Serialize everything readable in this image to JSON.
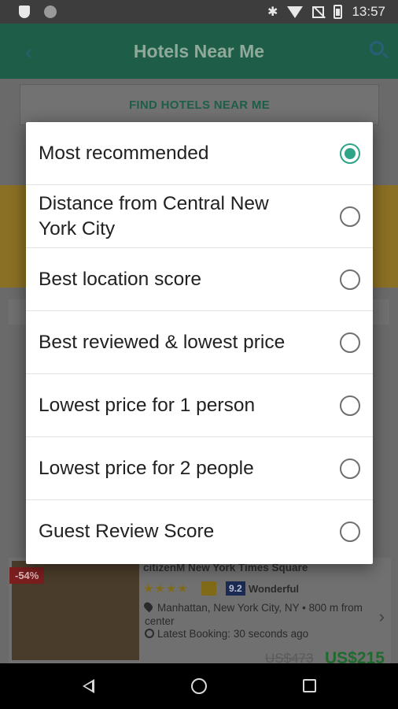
{
  "status_bar": {
    "time": "13:57",
    "icons": [
      "shield-icon",
      "circle-icon",
      "bluetooth-icon",
      "wifi-icon",
      "no-signal-icon",
      "battery-icon"
    ]
  },
  "app_bar": {
    "title": "Hotels Near Me",
    "back_icon": "back-arrow-icon",
    "search_icon": "search-icon"
  },
  "background": {
    "find_button_label": "FIND HOTELS NEAR ME",
    "hotel": {
      "discount": "-54%",
      "name": "citizenM New York Times Square",
      "stars": "★★★★",
      "score": "9.2",
      "score_label": "Wonderful",
      "location": "Manhattan, New York City, NY • 800 m from center",
      "latest_booking": "Latest Booking: 30 seconds ago",
      "old_price": "US$473",
      "price": "US$215"
    }
  },
  "sort_dialog": {
    "options": [
      {
        "label": "Most recommended",
        "selected": true
      },
      {
        "label": "Distance from Central New York City",
        "selected": false
      },
      {
        "label": "Best location score",
        "selected": false
      },
      {
        "label": "Best reviewed & lowest price",
        "selected": false
      },
      {
        "label": "Lowest price for 1 person",
        "selected": false
      },
      {
        "label": "Lowest price for 2 people",
        "selected": false
      },
      {
        "label": "Guest Review Score",
        "selected": false
      }
    ]
  },
  "colors": {
    "accent": "#2fa489",
    "app_bar": "#2fa87f",
    "price": "#3fc65a"
  }
}
